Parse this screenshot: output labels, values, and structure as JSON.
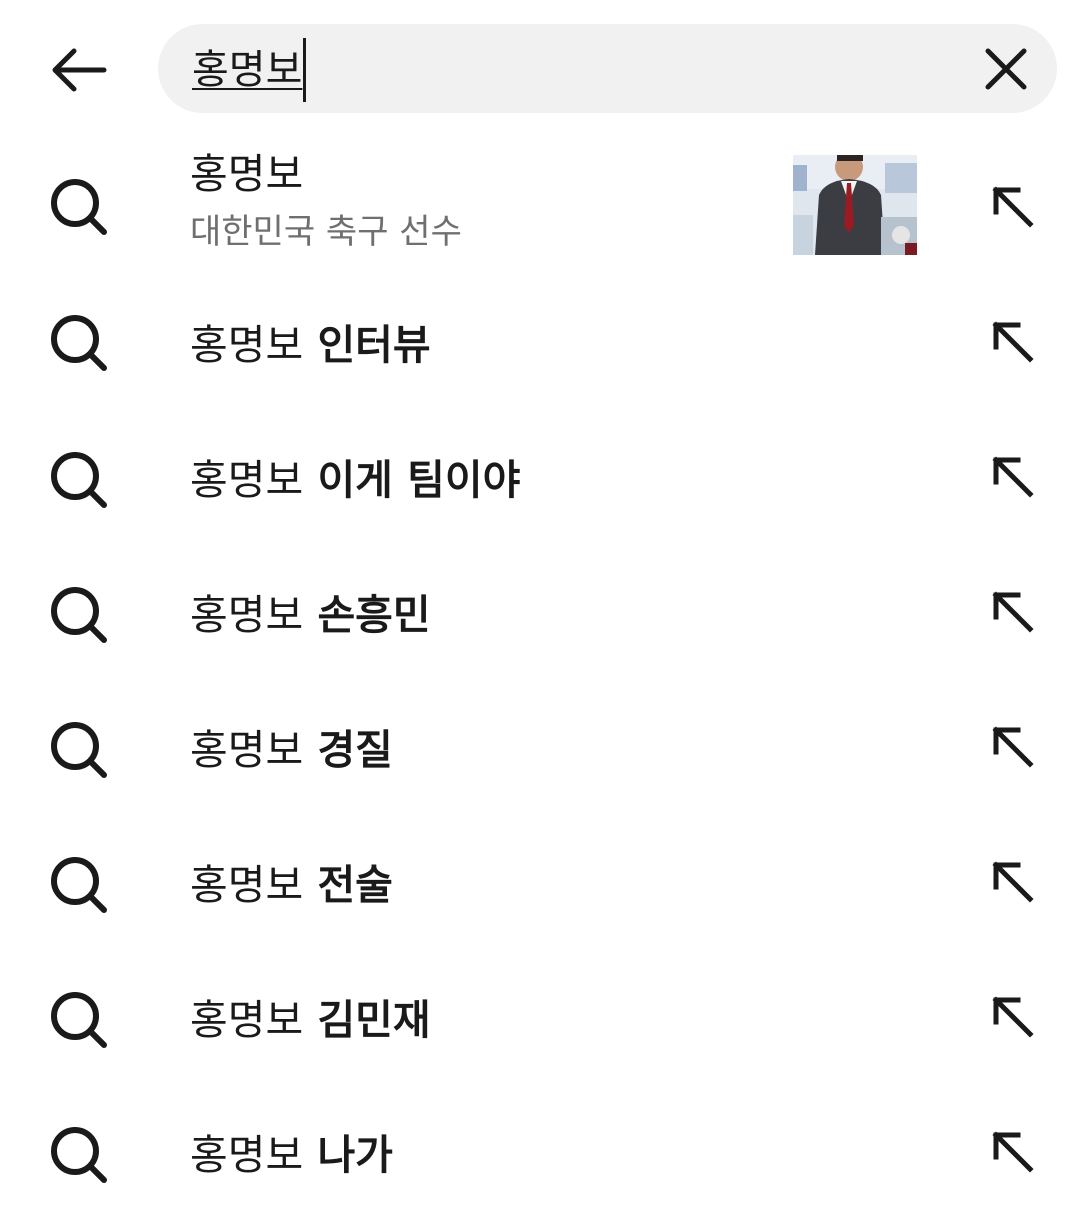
{
  "search": {
    "query": "홍명보",
    "back_icon": "arrow-left-icon",
    "clear_icon": "close-icon"
  },
  "suggestions": [
    {
      "query": "홍명보",
      "suffix": "",
      "subtitle": "대한민국 축구 선수",
      "has_thumbnail": true
    },
    {
      "query": "홍명보",
      "suffix": " 인터뷰"
    },
    {
      "query": "홍명보",
      "suffix": " 이게 팀이야"
    },
    {
      "query": "홍명보",
      "suffix": " 손흥민"
    },
    {
      "query": "홍명보",
      "suffix": " 경질"
    },
    {
      "query": "홍명보",
      "suffix": " 전술"
    },
    {
      "query": "홍명보",
      "suffix": " 김민재"
    },
    {
      "query": "홍명보",
      "suffix": " 나가"
    }
  ],
  "icons": {
    "row_leading": "search-icon",
    "row_trailing": "arrow-up-left-icon"
  },
  "colors": {
    "search_box_bg": "#f1f1f1",
    "text": "#1a1a1a",
    "subtitle": "#6f6f6f"
  }
}
